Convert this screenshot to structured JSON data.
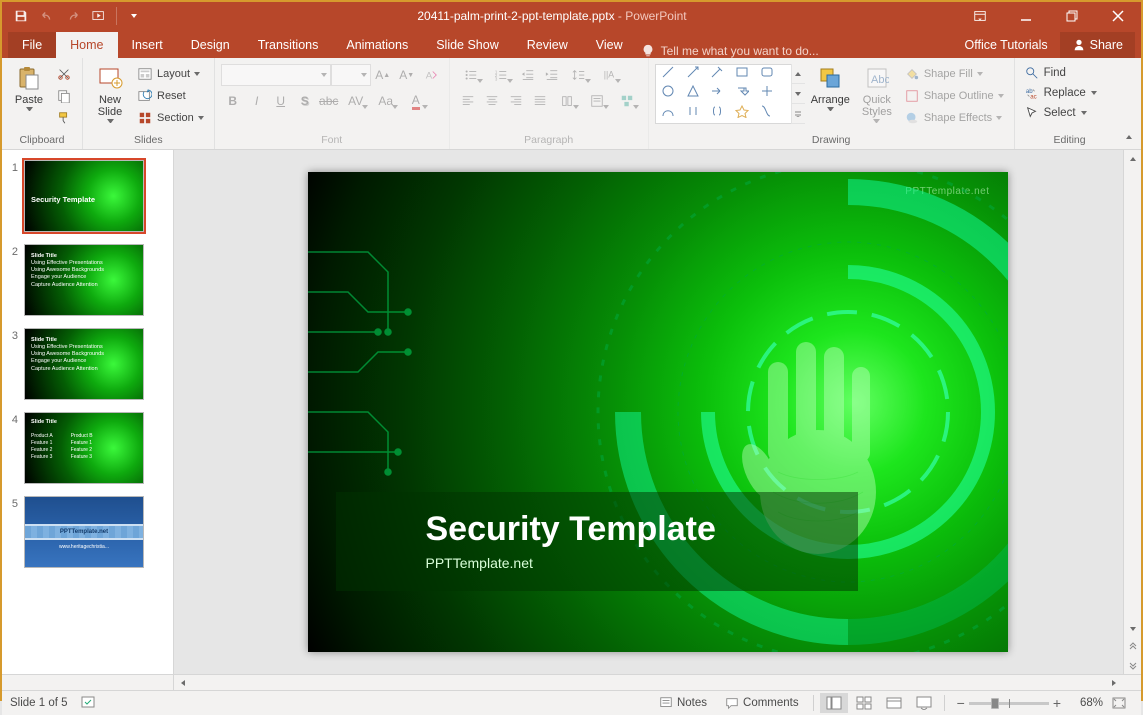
{
  "title_bar": {
    "document_name": "20411-palm-print-2-ppt-template.pptx",
    "app_name": "PowerPoint"
  },
  "tabs": {
    "file": "File",
    "home": "Home",
    "insert": "Insert",
    "design": "Design",
    "transitions": "Transitions",
    "animations": "Animations",
    "slideshow": "Slide Show",
    "review": "Review",
    "view": "View",
    "tell_me": "Tell me what you want to do...",
    "office_tutorials": "Office Tutorials",
    "share": "Share"
  },
  "ribbon": {
    "clipboard": {
      "label": "Clipboard",
      "paste": "Paste",
      "cut": "Cut",
      "copy": "Copy",
      "format_painter": "Format Painter"
    },
    "slides": {
      "label": "Slides",
      "new_slide": "New\nSlide",
      "layout": "Layout",
      "reset": "Reset",
      "section": "Section"
    },
    "font": {
      "label": "Font"
    },
    "paragraph": {
      "label": "Paragraph"
    },
    "drawing": {
      "label": "Drawing",
      "arrange": "Arrange",
      "quick_styles": "Quick\nStyles",
      "shape_fill": "Shape Fill",
      "shape_outline": "Shape Outline",
      "shape_effects": "Shape Effects"
    },
    "editing": {
      "label": "Editing",
      "find": "Find",
      "replace": "Replace",
      "select": "Select"
    }
  },
  "thumbnails": [
    {
      "num": "1",
      "type": "title",
      "title": "Security Template"
    },
    {
      "num": "2",
      "type": "list",
      "heading": "Slide Title",
      "items": [
        "Using Effective Presentations",
        "Using Awesome Backgrounds",
        "Engage your Audience",
        "Capture Audience Attention"
      ]
    },
    {
      "num": "3",
      "type": "list",
      "heading": "Slide Title",
      "items": [
        "Using Effective Presentations",
        "Using Awesome Backgrounds",
        "Engage your Audience",
        "Capture Audience Attention"
      ]
    },
    {
      "num": "4",
      "type": "cols",
      "heading": "Slide Title",
      "col1": [
        "Product A",
        "Feature 1",
        "Feature 2",
        "Feature 3"
      ],
      "col2": [
        "Product B",
        "Feature 1",
        "Feature 2",
        "Feature 3"
      ]
    },
    {
      "num": "5",
      "type": "blue",
      "bar": "PPTTemplate.net",
      "site": "www.heritagechristia..."
    }
  ],
  "slide": {
    "watermark": "PPTTemplate.net",
    "title": "Security Template",
    "subtitle": "PPTTemplate.net"
  },
  "status": {
    "slide_info": "Slide 1 of 5",
    "notes": "Notes",
    "comments": "Comments",
    "zoom": "68%"
  }
}
